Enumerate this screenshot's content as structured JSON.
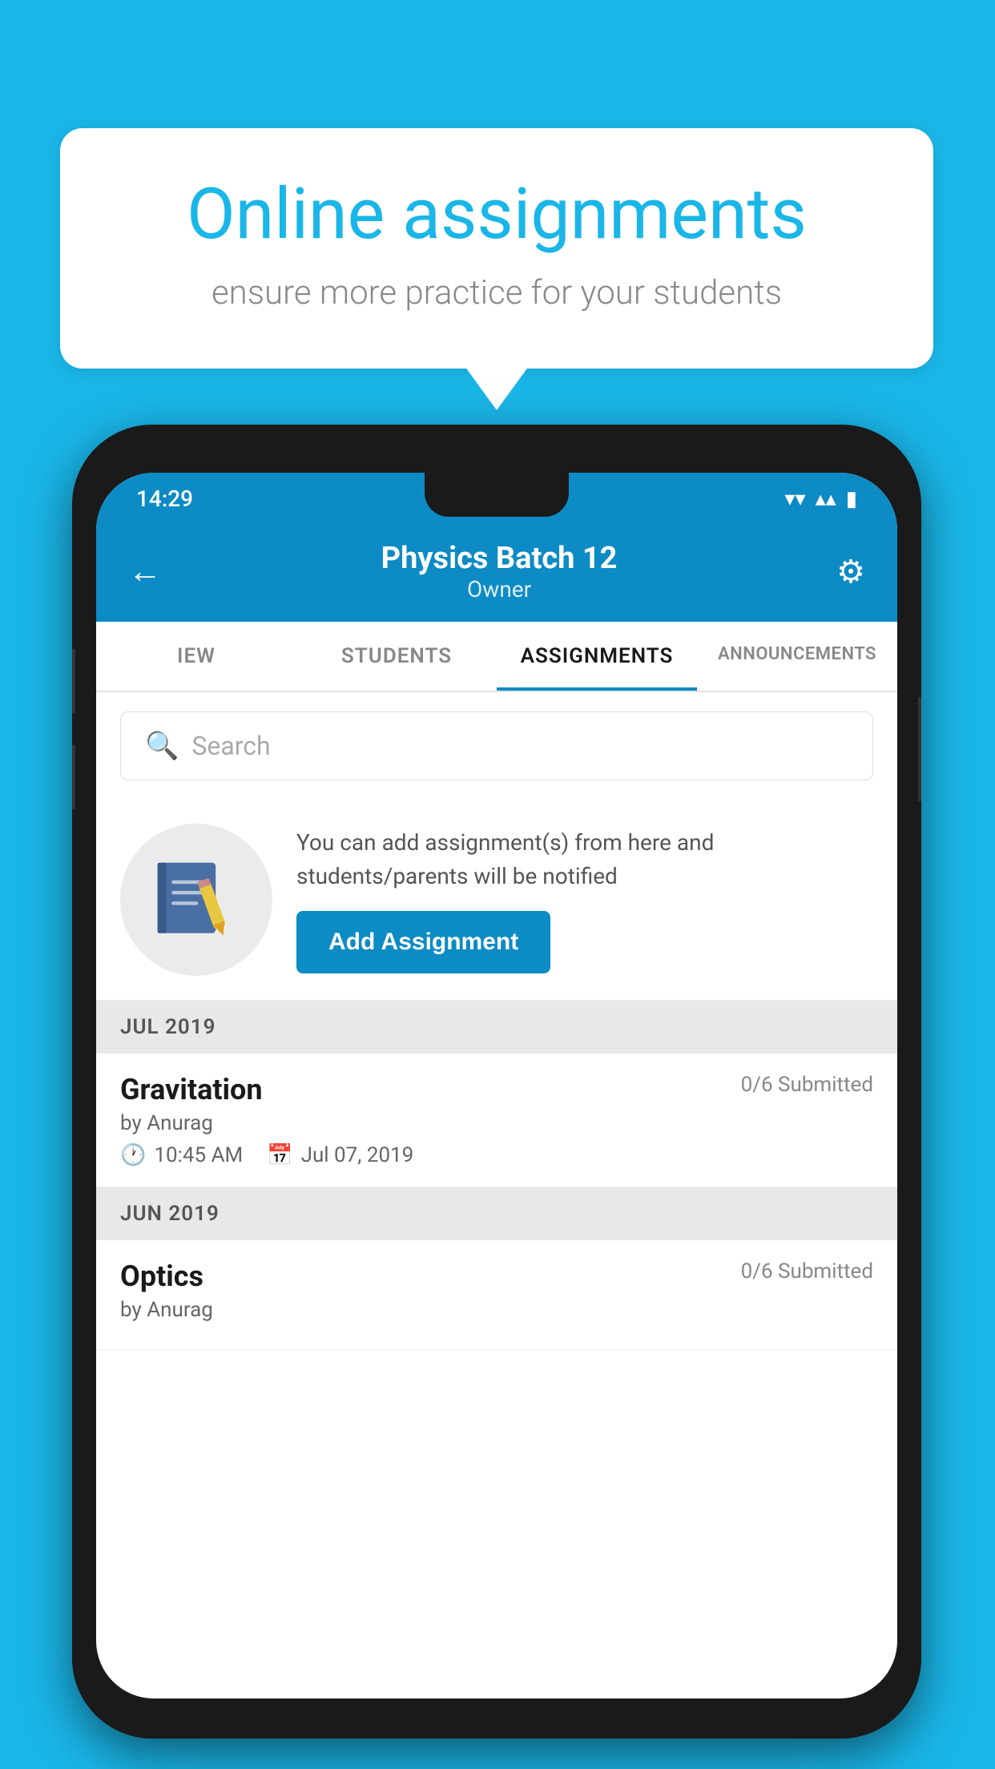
{
  "background_color": "#1ab6e8",
  "speech_bubble": {
    "title": "Online assignments",
    "subtitle": "ensure more practice for your students"
  },
  "status_bar": {
    "time": "14:29",
    "wifi": "▾",
    "signal": "▴",
    "battery": "▮"
  },
  "header": {
    "title": "Physics Batch 12",
    "subtitle": "Owner",
    "back_label": "←",
    "settings_label": "⚙"
  },
  "tabs": [
    {
      "id": "iew",
      "label": "IEW",
      "active": false
    },
    {
      "id": "students",
      "label": "STUDENTS",
      "active": false
    },
    {
      "id": "assignments",
      "label": "ASSIGNMENTS",
      "active": true
    },
    {
      "id": "announcements",
      "label": "ANNOUNCEMENTS",
      "active": false
    }
  ],
  "search": {
    "placeholder": "Search"
  },
  "add_assignment": {
    "description": "You can add assignment(s) from here and students/parents will be notified",
    "button_label": "Add Assignment"
  },
  "sections": [
    {
      "month": "JUL 2019",
      "assignments": [
        {
          "name": "Gravitation",
          "submitted": "0/6 Submitted",
          "author": "by Anurag",
          "time": "10:45 AM",
          "date": "Jul 07, 2019"
        }
      ]
    },
    {
      "month": "JUN 2019",
      "assignments": [
        {
          "name": "Optics",
          "submitted": "0/6 Submitted",
          "author": "by Anurag",
          "time": "",
          "date": ""
        }
      ]
    }
  ]
}
